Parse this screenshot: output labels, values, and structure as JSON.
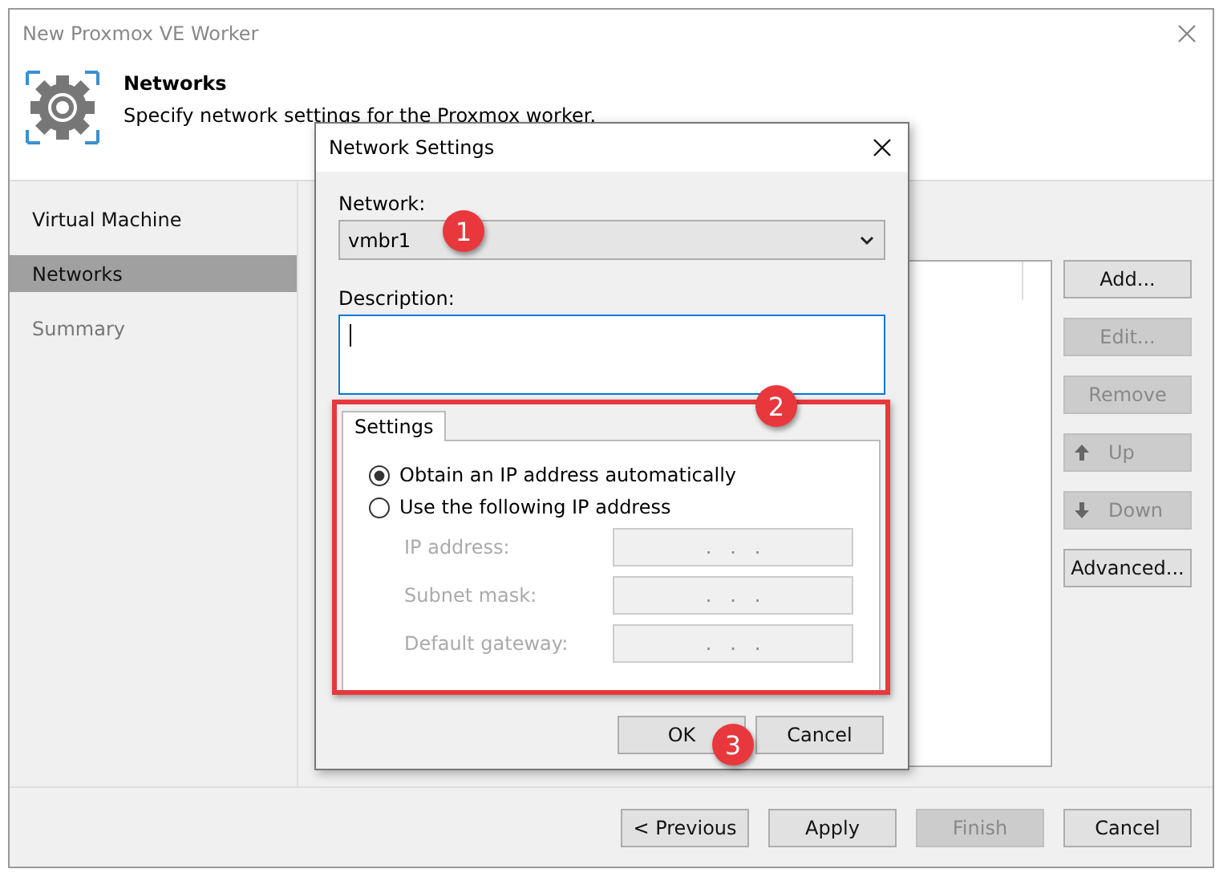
{
  "window": {
    "title": "New Proxmox VE Worker"
  },
  "header": {
    "title": "Networks",
    "subtitle": "Specify network settings for the Proxmox worker."
  },
  "sidebar": {
    "items": [
      {
        "label": "Virtual Machine",
        "selected": false,
        "disabled": false
      },
      {
        "label": "Networks",
        "selected": true,
        "disabled": false
      },
      {
        "label": "Summary",
        "selected": false,
        "disabled": true
      }
    ]
  },
  "side_buttons": [
    {
      "label": "Add...",
      "disabled": false,
      "kind": "plain"
    },
    {
      "label": "Edit...",
      "disabled": true,
      "kind": "plain"
    },
    {
      "label": "Remove",
      "disabled": true,
      "kind": "plain"
    },
    {
      "label": "Up",
      "disabled": true,
      "kind": "up"
    },
    {
      "label": "Down",
      "disabled": true,
      "kind": "down"
    },
    {
      "label": "Advanced...",
      "disabled": false,
      "kind": "plain"
    }
  ],
  "footer_buttons": [
    {
      "label": "< Previous",
      "disabled": false
    },
    {
      "label": "Apply",
      "disabled": false
    },
    {
      "label": "Finish",
      "disabled": true
    },
    {
      "label": "Cancel",
      "disabled": false
    }
  ],
  "dialog": {
    "title": "Network Settings",
    "network_label": "Network:",
    "network_value": "vmbr1",
    "description_label": "Description:",
    "tab": "Settings",
    "options": [
      {
        "label": "Obtain an IP address automatically",
        "selected": true
      },
      {
        "label": "Use the following IP address",
        "selected": false
      }
    ],
    "ip_fields": [
      {
        "label": "IP address:",
        "value": ".   .   .",
        "disabled": true
      },
      {
        "label": "Subnet mask:",
        "value": ".   .   .",
        "disabled": true
      },
      {
        "label": "Default gateway:",
        "value": ".   .   .",
        "disabled": true
      }
    ],
    "buttons": [
      "OK",
      "Cancel"
    ]
  },
  "annotations": [
    {
      "label": "1"
    },
    {
      "label": "2"
    },
    {
      "label": "3"
    }
  ]
}
